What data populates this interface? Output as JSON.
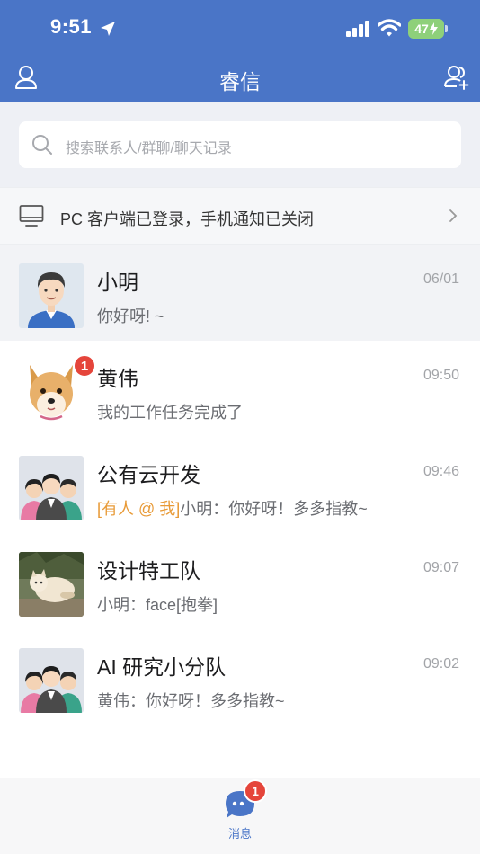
{
  "status_bar": {
    "time": "9:51",
    "battery": "47"
  },
  "header": {
    "title": "睿信"
  },
  "search": {
    "placeholder": "搜索联系人/群聊/聊天记录"
  },
  "pc_notice": {
    "text": "PC 客户端已登录，手机通知已关闭"
  },
  "chats": [
    {
      "name": "小明",
      "time": "06/01",
      "preview": "你好呀! ~",
      "mention": "",
      "badge": "",
      "avatar": "man-avatar"
    },
    {
      "name": "黄伟",
      "time": "09:50",
      "preview": "我的工作任务完成了",
      "mention": "",
      "badge": "1",
      "avatar": "dog-avatar"
    },
    {
      "name": "公有云开发",
      "time": "09:46",
      "preview": "小明：你好呀！多多指教~",
      "mention": "[有人 @ 我]",
      "badge": "",
      "avatar": "group-avatar"
    },
    {
      "name": "设计特工队",
      "time": "09:07",
      "preview": "小明：face[抱拳]",
      "mention": "",
      "badge": "",
      "avatar": "cat-photo-avatar"
    },
    {
      "name": "AI 研究小分队",
      "time": "09:02",
      "preview": "黄伟：你好呀！多多指教~",
      "mention": "",
      "badge": "",
      "avatar": "group-avatar"
    }
  ],
  "tab_bar": {
    "messages_label": "消息",
    "messages_badge": "1"
  },
  "colors": {
    "brand": "#4a75c7",
    "badge": "#e5453b",
    "mention": "#e89a37"
  }
}
